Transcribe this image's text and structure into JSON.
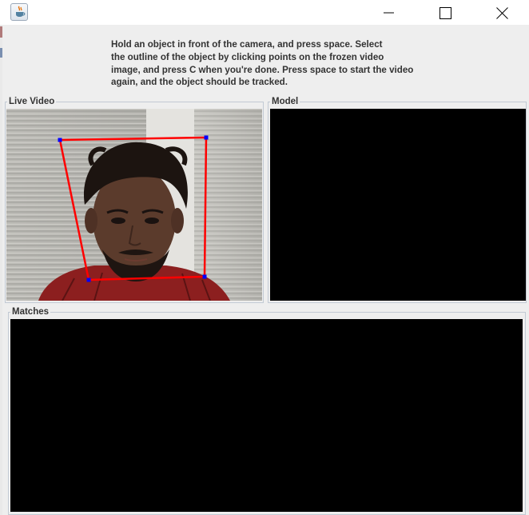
{
  "window": {
    "app_icon": "java-cup-icon",
    "controls": {
      "minimize_icon": "minimize-icon",
      "maximize_icon": "maximize-icon",
      "close_icon": "close-icon"
    }
  },
  "instructions": {
    "text": "Hold an object in front of the camera, and press space. Select\nthe outline of the object by clicking points on the frozen video\nimage, and press C when you're done. Press space to start the video\nagain, and the object should be tracked."
  },
  "panels": {
    "live_video": {
      "title": "Live Video"
    },
    "model": {
      "title": "Model"
    },
    "matches": {
      "title": "Matches"
    }
  },
  "colors": {
    "window_bg": "#eeeeee",
    "panel_border": "#c2cad4",
    "label_text": "#333333",
    "video_bg": "#000000",
    "outline_stroke": "#ff0000",
    "outline_point": "#0000ff"
  }
}
